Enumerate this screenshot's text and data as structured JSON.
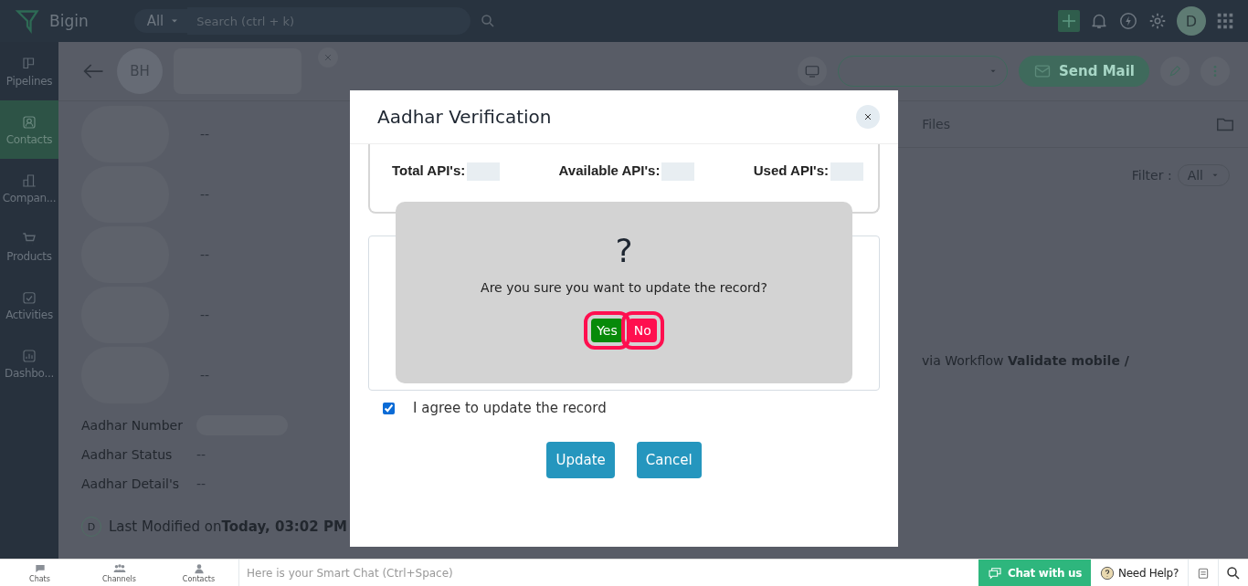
{
  "top_bar": {
    "app_name": "Bigin",
    "search_scope": "All",
    "search": {
      "placeholder": "Search (ctrl + k)"
    },
    "avatar": "D"
  },
  "sidebar": {
    "items": [
      {
        "label": "Pipelines",
        "selected": false
      },
      {
        "label": "Contacts",
        "selected": true
      },
      {
        "label": "Compan...",
        "selected": false
      },
      {
        "label": "Products",
        "selected": false
      },
      {
        "label": "Activities",
        "selected": false
      },
      {
        "label": "Dashbo...",
        "selected": false
      }
    ]
  },
  "record": {
    "initials": "BH",
    "send_mail": "Send Mail",
    "tab": "Files",
    "filter_label": "Filter :",
    "filter_value": "All",
    "blurred_fields": [
      "--",
      "--",
      "--",
      "--",
      "--"
    ],
    "fields": [
      {
        "label": "Aadhar Number"
      },
      {
        "label": "Aadhar Status",
        "value": "--"
      },
      {
        "label": "Aadhar Detail's",
        "value": "--"
      }
    ],
    "last_modified": {
      "avatar": "D",
      "text": "Last Modified on**Today, 03:02 PM**"
    },
    "timeline_note": "via Workflow **Validate mobile /**"
  },
  "modal": {
    "title": "Aadhar Verification",
    "stats": [
      "Total API's:",
      "Available API's:",
      "Used API's:"
    ],
    "agree": {
      "label": "I agree to update the record",
      "checked": true
    },
    "buttons": [
      "Update",
      "Cancel"
    ]
  },
  "confirm": {
    "symbol": "?",
    "message": "Are you sure you want to update the record?",
    "buttons": [
      {
        "label": "Yes",
        "kind": "confirm"
      },
      {
        "label": "No",
        "kind": "deny"
      }
    ]
  },
  "bottom_bar": {
    "tabs": [
      "Chats",
      "Channels",
      "Contacts"
    ],
    "smart_chat": {
      "placeholder": "Here is your Smart Chat (Ctrl+Space)"
    },
    "chat_button": "Chat with us",
    "help": "Need Help?"
  }
}
